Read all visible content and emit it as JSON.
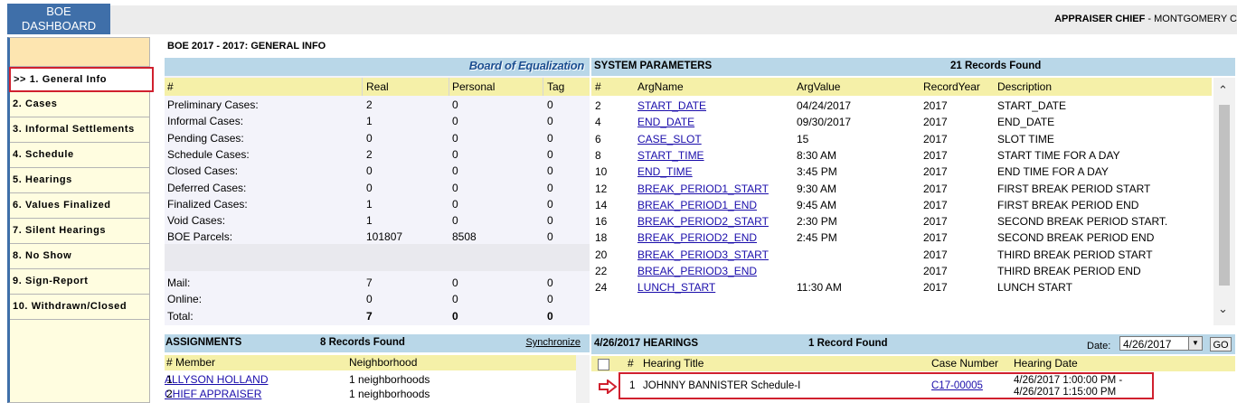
{
  "header": {
    "tab_line1": "BOE",
    "tab_line2": "DASHBOARD",
    "user_role": "APPRAISER CHIEF",
    "user_sep": " - ",
    "county": "MONTGOMERY C"
  },
  "sidebar": {
    "items": [
      {
        "label": ">> 1. General Info",
        "active": true
      },
      {
        "label": "2. Cases"
      },
      {
        "label": "3. Informal Settlements"
      },
      {
        "label": "4. Schedule"
      },
      {
        "label": "5. Hearings"
      },
      {
        "label": "6. Values Finalized"
      },
      {
        "label": "7. Silent Hearings"
      },
      {
        "label": "8. No Show"
      },
      {
        "label": "9. Sign-Report"
      },
      {
        "label": "10. Withdrawn/Closed"
      }
    ]
  },
  "section_title": "BOE 2017 - 2017: GENERAL INFO",
  "general_info": {
    "brand": "Board of Equalization",
    "columns": [
      "#",
      "Real",
      "Personal",
      "Tag"
    ],
    "rows": [
      [
        "Preliminary Cases:",
        "2",
        "0",
        "0"
      ],
      [
        "Informal Cases:",
        "1",
        "0",
        "0"
      ],
      [
        "Pending Cases:",
        "0",
        "0",
        "0"
      ],
      [
        "Schedule Cases:",
        "2",
        "0",
        "0"
      ],
      [
        "Closed Cases:",
        "0",
        "0",
        "0"
      ],
      [
        "Deferred Cases:",
        "0",
        "0",
        "0"
      ],
      [
        "Finalized Cases:",
        "1",
        "0",
        "0"
      ],
      [
        "Void Cases:",
        "1",
        "0",
        "0"
      ],
      [
        "BOE Parcels:",
        "101807",
        "8508",
        "0"
      ]
    ],
    "rows2": [
      [
        "Mail:",
        "7",
        "0",
        "0"
      ],
      [
        "Online:",
        "0",
        "0",
        "0"
      ],
      [
        "Total:",
        "7",
        "0",
        "0"
      ]
    ]
  },
  "system_params": {
    "title": "SYSTEM PARAMETERS",
    "records": "21 Records Found",
    "columns": [
      "#",
      "ArgName",
      "ArgValue",
      "RecordYear",
      "Description"
    ],
    "rows": [
      [
        "2",
        "START_DATE",
        "04/24/2017",
        "2017",
        "START_DATE"
      ],
      [
        "4",
        "END_DATE",
        "09/30/2017",
        "2017",
        "END_DATE"
      ],
      [
        "6",
        "CASE_SLOT",
        "15",
        "2017",
        "SLOT TIME"
      ],
      [
        "8",
        "START_TIME",
        "8:30 AM",
        "2017",
        "START TIME FOR A DAY"
      ],
      [
        "10",
        "END_TIME",
        "3:45 PM",
        "2017",
        "END TIME FOR A DAY"
      ],
      [
        "12",
        "BREAK_PERIOD1_START",
        "9:30 AM",
        "2017",
        "FIRST BREAK PERIOD START"
      ],
      [
        "14",
        "BREAK_PERIOD1_END",
        "9:45 AM",
        "2017",
        "FIRST BREAK PERIOD END"
      ],
      [
        "16",
        "BREAK_PERIOD2_START",
        "2:30 PM",
        "2017",
        "SECOND BREAK PERIOD START."
      ],
      [
        "18",
        "BREAK_PERIOD2_END",
        "2:45 PM",
        "2017",
        "SECOND BREAK PERIOD END"
      ],
      [
        "20",
        "BREAK_PERIOD3_START",
        "",
        "2017",
        "THIRD BREAK PERIOD START"
      ],
      [
        "22",
        "BREAK_PERIOD3_END",
        "",
        "2017",
        "THIRD BREAK PERIOD END"
      ],
      [
        "24",
        "LUNCH_START",
        "11:30 AM",
        "2017",
        "LUNCH START"
      ]
    ]
  },
  "assignments": {
    "title": "ASSIGNMENTS",
    "records": "8 Records Found",
    "sync_label": "Synchronize",
    "columns": [
      "# Member",
      "Neighborhood"
    ],
    "rows": [
      [
        "1",
        "ALLYSON HOLLAND",
        "1 neighborhoods"
      ],
      [
        "2",
        "CHIEF APPRAISER",
        "1 neighborhoods"
      ]
    ]
  },
  "hearings": {
    "title": "4/26/2017 HEARINGS",
    "records": "1 Record Found",
    "date_label": "Date:",
    "date_value": "4/26/2017",
    "go_label": "GO",
    "columns": [
      "#",
      "Hearing Title",
      "Case Number",
      "Hearing Date"
    ],
    "rows": [
      [
        "1",
        "JOHNNY BANNISTER Schedule-I",
        "C17-00005",
        "4/26/2017 1:00:00 PM -",
        "4/26/2017 1:15:00 PM"
      ]
    ]
  },
  "colors": {
    "accent_blue": "#3f6fa9",
    "highlight_red": "#d0202e",
    "header_yellow": "#f5f0a8",
    "bar_blue": "#b9d7e8"
  }
}
